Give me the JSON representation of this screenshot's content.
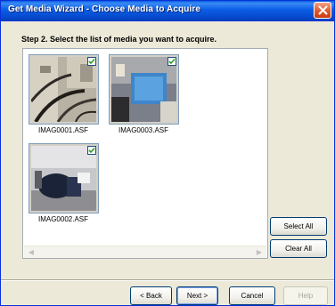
{
  "window": {
    "title": "Get Media Wizard - Choose Media to Acquire"
  },
  "instruction": "Step 2. Select the list of media you want to acquire.",
  "media_items": [
    {
      "label": "IMAG0001.ASF",
      "checked": true
    },
    {
      "label": "IMAG0003.ASF",
      "checked": true
    },
    {
      "label": "IMAG0002.ASF",
      "checked": true
    }
  ],
  "buttons": {
    "select_all": "Select All",
    "clear_all": "Clear All",
    "back": "Back",
    "next": "Next",
    "cancel": "Cancel",
    "help": "Help"
  },
  "colors": {
    "title_bar": "#0b5ee6",
    "close_button": "#e15e33",
    "check_mark": "#21a121"
  }
}
